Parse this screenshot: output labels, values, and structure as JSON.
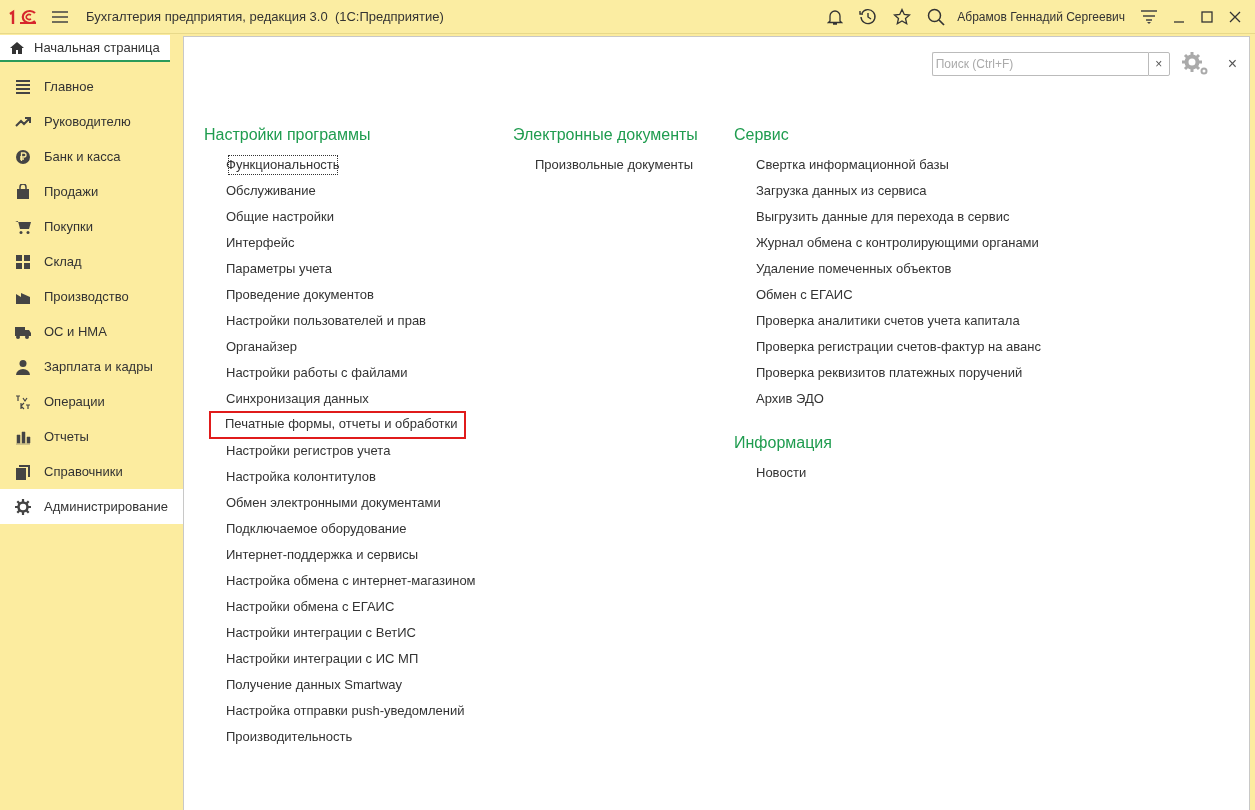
{
  "window": {
    "title": "Бухгалтерия предприятия, редакция 3.0  (1С:Предприятие)",
    "user": "Абрамов Геннадий Сергеевич"
  },
  "tabs": [
    {
      "label": "Начальная страница",
      "selected": true
    }
  ],
  "sidebar": {
    "items": [
      {
        "label": "Главное",
        "selected": false
      },
      {
        "label": "Руководителю",
        "selected": false
      },
      {
        "label": "Банк и касса",
        "selected": false
      },
      {
        "label": "Продажи",
        "selected": false
      },
      {
        "label": "Покупки",
        "selected": false
      },
      {
        "label": "Склад",
        "selected": false
      },
      {
        "label": "Производство",
        "selected": false
      },
      {
        "label": "ОС и НМА",
        "selected": false
      },
      {
        "label": "Зарплата и кадры",
        "selected": false
      },
      {
        "label": "Операции",
        "selected": false
      },
      {
        "label": "Отчеты",
        "selected": false
      },
      {
        "label": "Справочники",
        "selected": false
      },
      {
        "label": "Администрирование",
        "selected": true
      }
    ]
  },
  "search": {
    "placeholder": "Поиск (Ctrl+F)",
    "clear": "×"
  },
  "close": "×",
  "columns": [
    {
      "sections": [
        {
          "title": "Настройки программы",
          "links": [
            {
              "label": "Функциональность",
              "focused": true,
              "highlighted": false
            },
            {
              "label": "Обслуживание",
              "focused": false,
              "highlighted": false
            },
            {
              "label": "Общие настройки",
              "focused": false,
              "highlighted": false
            },
            {
              "label": "Интерфейс",
              "focused": false,
              "highlighted": false
            },
            {
              "label": "Параметры учета",
              "focused": false,
              "highlighted": false
            },
            {
              "label": "Проведение документов",
              "focused": false,
              "highlighted": false
            },
            {
              "label": "Настройки пользователей и прав",
              "focused": false,
              "highlighted": false
            },
            {
              "label": "Органайзер",
              "focused": false,
              "highlighted": false
            },
            {
              "label": "Настройки работы с файлами",
              "focused": false,
              "highlighted": false
            },
            {
              "label": "Синхронизация данных",
              "focused": false,
              "highlighted": false
            },
            {
              "label": "Печатные формы, отчеты и обработки",
              "focused": false,
              "highlighted": true
            },
            {
              "label": "Настройки регистров учета",
              "focused": false,
              "highlighted": false
            },
            {
              "label": "Настройка колонтитулов",
              "focused": false,
              "highlighted": false
            },
            {
              "label": "Обмен электронными документами",
              "focused": false,
              "highlighted": false
            },
            {
              "label": "Подключаемое оборудование",
              "focused": false,
              "highlighted": false
            },
            {
              "label": "Интернет-поддержка и сервисы",
              "focused": false,
              "highlighted": false
            },
            {
              "label": "Настройка обмена с интернет-магазином",
              "focused": false,
              "highlighted": false
            },
            {
              "label": "Настройки обмена с ЕГАИС",
              "focused": false,
              "highlighted": false
            },
            {
              "label": "Настройки интеграции с ВетИС",
              "focused": false,
              "highlighted": false
            },
            {
              "label": "Настройки интеграции с ИС МП",
              "focused": false,
              "highlighted": false
            },
            {
              "label": "Получение данных Smartway",
              "focused": false,
              "highlighted": false
            },
            {
              "label": "Настройка отправки push-уведомлений",
              "focused": false,
              "highlighted": false
            },
            {
              "label": "Производительность",
              "focused": false,
              "highlighted": false
            }
          ]
        }
      ]
    },
    {
      "sections": [
        {
          "title": "Электронные документы",
          "links": [
            {
              "label": "Произвольные документы",
              "focused": false,
              "highlighted": false
            }
          ]
        }
      ]
    },
    {
      "sections": [
        {
          "title": "Сервис",
          "links": [
            {
              "label": "Свертка информационной базы",
              "focused": false,
              "highlighted": false
            },
            {
              "label": "Загрузка данных из сервиса",
              "focused": false,
              "highlighted": false
            },
            {
              "label": "Выгрузить данные для перехода в сервис",
              "focused": false,
              "highlighted": false
            },
            {
              "label": "Журнал обмена с контролирующими органами",
              "focused": false,
              "highlighted": false
            },
            {
              "label": "Удаление помеченных объектов",
              "focused": false,
              "highlighted": false
            },
            {
              "label": "Обмен с ЕГАИС",
              "focused": false,
              "highlighted": false
            },
            {
              "label": "Проверка аналитики счетов учета капитала",
              "focused": false,
              "highlighted": false
            },
            {
              "label": "Проверка регистрации счетов-фактур на аванс",
              "focused": false,
              "highlighted": false
            },
            {
              "label": "Проверка реквизитов платежных поручений",
              "focused": false,
              "highlighted": false
            },
            {
              "label": "Архив ЭДО",
              "focused": false,
              "highlighted": false
            }
          ]
        },
        {
          "title": "Информация",
          "links": [
            {
              "label": "Новости",
              "focused": false,
              "highlighted": false
            }
          ]
        }
      ]
    }
  ]
}
